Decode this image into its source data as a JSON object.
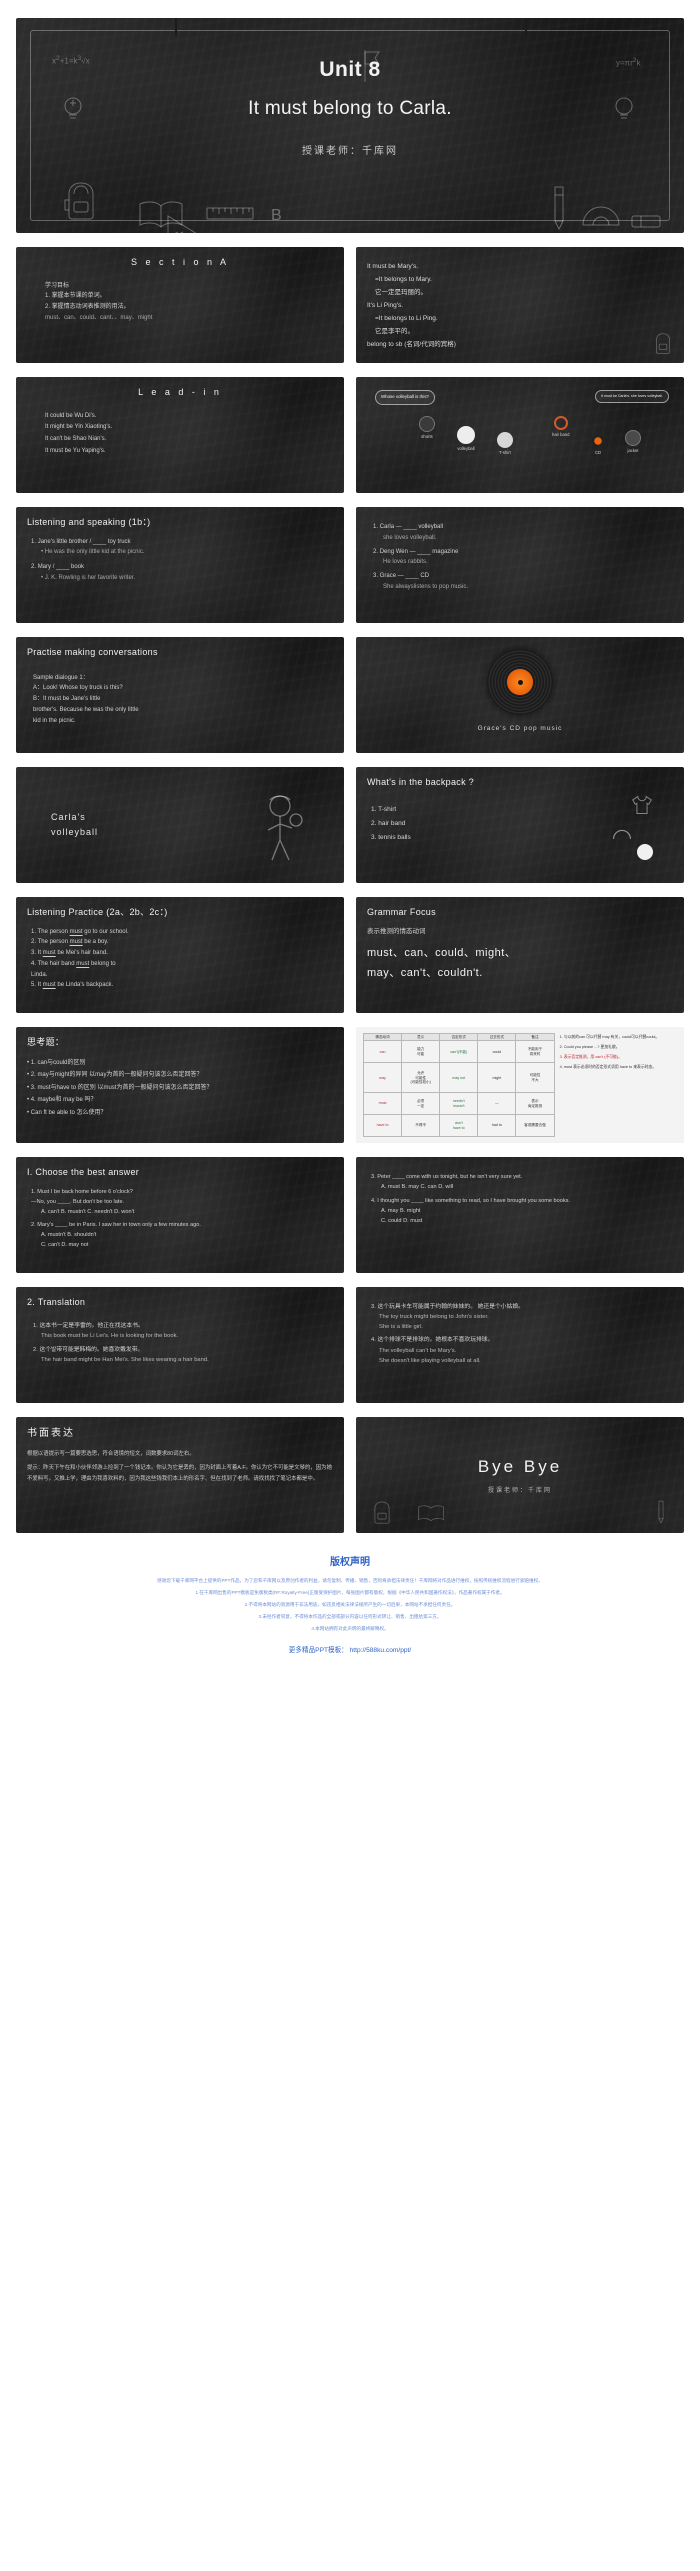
{
  "title_slide": {
    "unit": "Unit 8",
    "main": "It must belong to Carla.",
    "teacher": "授课老师：千库网"
  },
  "slides": [
    {
      "id": "section-a",
      "title": "S e c t i o n   A",
      "lines": [
        "学习目标",
        "1. 掌握本节课的单词。",
        "2. 掌握情态动词表推测的用法。",
        "must、can、could、cant、、may、might"
      ]
    },
    {
      "id": "belong-to",
      "lines": [
        "It must be Mary's.",
        "=It belongs to Mary.",
        "它一定是玛丽的。",
        "It's Li Ping's.",
        "=It belongs to Li Ping.",
        "它是李平的。",
        "belong to sb (名词/代词的宾格)"
      ]
    },
    {
      "id": "lead-in",
      "title": "L e a d - i n",
      "lines": [
        "It could be Wu Di's.",
        "It might be Yin Xiaoting's.",
        "It can't be Shao Nian's.",
        "It must be Yu Yaping's."
      ]
    },
    {
      "id": "whose-picture",
      "bubble_left": "Whose volleyball is this?",
      "bubble_right": "It must be Carla's. she loves volleyball.",
      "items": [
        "shorts",
        "volleyball",
        "T-shirt",
        "hair band",
        "CD",
        "jacket"
      ]
    },
    {
      "id": "listening-speaking-1b",
      "title": "Listening and speaking (1b：)",
      "items": [
        {
          "n": "1.",
          "q": "Jane's little brother / ____ toy truck",
          "a": "He was the only little kid at the picnic."
        },
        {
          "n": "2.",
          "q": "Mary / ____ book",
          "a": "J. K. Rowling  is her favorite writer."
        }
      ]
    },
    {
      "id": "listening-speaking-right",
      "items": [
        {
          "n": "1.",
          "q": "Carla — ____ volleyball",
          "a": "she loves volleyball."
        },
        {
          "n": "2.",
          "q": "Deng Wen — ____ magazine",
          "a": "He loves rabbits."
        },
        {
          "n": "3.",
          "q": "Grace — ____ CD",
          "a": "She alwayslistens to pop music."
        }
      ]
    },
    {
      "id": "practise-conversations",
      "title": "Practise making conversations",
      "lines": [
        "Sample dialogue 1：",
        "A：Look! Whose toy truck is this?",
        "B：It must be Jane's little",
        "brother's. Because he  was the only little",
        "kid in the picnic."
      ]
    },
    {
      "id": "grace-cd",
      "caption": "Grace's CD       pop       music"
    },
    {
      "id": "carla-volleyball",
      "text": "Carla's\nvolleyball"
    },
    {
      "id": "backpack",
      "title": "What's in the backpack ?",
      "items": [
        "1. T-shirt",
        "2. hair band",
        "3. tennis balls"
      ]
    },
    {
      "id": "listening-practice",
      "title": "Listening Practice (2a、2b、2c：)",
      "items": [
        "1. The person <u>must</u>  go to  our school.",
        "2. The person <u>must</u>  be a boy.",
        "3. It <u>must</u>  be Mei's hair band.",
        "4. The hair band <u>must</u>  belong to",
        "Linda.",
        "5. It <u>must</u> be Linda's backpack."
      ]
    },
    {
      "id": "grammar-focus",
      "title": "Grammar Focus",
      "subtitle": "表示推测的情态动词",
      "main": "must、can、could、might、\nmay、can't、couldn't."
    },
    {
      "id": "think",
      "title": "思考题：",
      "items": [
        "• 1. can与could的区别",
        "• 2. may与might的异同  以may为首的一般疑问句该怎么否定回答？",
        "• 3. must与have to 的区别  以must为首的一般疑问句该怎么否定回答？",
        "• 4. maybe和  may  be  吗？",
        "• Can  ft be able to 怎么使用？"
      ]
    },
    {
      "id": "modal-table",
      "table": {
        "headers": [
          "情态动词",
          "意义",
          "否定形式",
          "过去形式",
          "备注"
        ],
        "rows": [
          [
            "can",
            "能力\n可能",
            "can't(不能)",
            "could",
            "不能用于\n将来时"
          ],
          [
            "may",
            "允许\n可能性\n(可能性较小)",
            "may not",
            "might",
            "可能性\n不大"
          ],
          [
            "must",
            "必须\n一定",
            "needn't\nmustn't",
            "—",
            "表示\n肯定推测"
          ],
          [
            "have to",
            "不得不",
            "don't\nhave to",
            "had to",
            "客观需要去做"
          ]
        ]
      },
      "notes": [
        "1. 与以前的can  可以代替 may  有关，could可以代替could。",
        "2. Could you please ...? 更加礼貌。",
        "3. 表示否定推测，用 can't (不可能)。",
        "4. must 表示必须时的否定形式须用 have to 来表示时态。"
      ]
    },
    {
      "id": "choose-best-answer",
      "title": "I. Choose the best answer",
      "items": [
        "1. Must I be back home before 6 o'clock?",
        "—No, you ____. But don't be too late.",
        "A. can't   B. mustn't   C. needn't   D. won't",
        "2. Mary's ____ be in Paris. I saw her in town only a few minutes ago.",
        "A. mustn't   B. shouldn't",
        "C. can't         D. may not"
      ]
    },
    {
      "id": "choose-best-answer-2",
      "items": [
        "3. Peter ____ come with us tonight, but he isn't very sure yet.",
        "A. must   B. may   C. can   D. will",
        "4. I thought you ____ like something to read, so I have brought you some books.",
        "A. may         B. might",
        "C. could       D. must"
      ]
    },
    {
      "id": "translation",
      "title": "2. Translation",
      "items": [
        "1. 这本书一定是李雷的。他正在找这本书。",
        "This book must be Li Lei's. He is looking for the book.",
        "2. 这个발带可能是韩梅的。她喜欢戴发带。",
        "The hair band might be Han Mei's. She likes wearing a hair band."
      ]
    },
    {
      "id": "translation-2",
      "items": [
        "3. 这个玩具卡车可能属于约翰的妹妹的。  她还是个小姑娘。",
        "The toy truck might belong to John's sister.",
        "She is a little girl.",
        "4. 这个排球不是排球的。她根本不喜欢玩排球。",
        "The volleyball can't be Mary's.",
        "She doesn't like playing volleyball at all."
      ]
    },
    {
      "id": "writing",
      "title": "书面表达",
      "lines": [
        "根据以语提示写一篇要思选思，符合语境的短文，词数要求80词左右。",
        "提示：昨天下午在和小伙伴郊游上捡到了一个钱记本。你认为它是丢的，因为封面上写着A.F。你认为它不可能是文琴的，因为她不爱料写。又推上学，理由为我喜欢料的，因为我这些钱我们本上的形名字、但在找到了老师。请找找找了笔记本都是中。"
      ]
    },
    {
      "id": "bye",
      "main": "Bye  Bye",
      "sub": "授课老师：千库网"
    }
  ],
  "copyright": {
    "title": "版权声明",
    "paragraphs": [
      "感谢您下载千库网平台上提供的PPT作品，为了您和千库网以及原创作者的利益，请勿复制、传播、销售，否则将承担法律责任！千库网将对作品进行维权，按照传统维权流程进行索赔维权。",
      "1.在千库网出售的PPT模板是免版税类(RF:Royalty-Free)正版受保护图片，每张图片都有版权，根据《中华人民共和国著作权法》，作品著作权属于作者。",
      "2.不得将本网站的资源用于非法用途，如违反相关法律法规所产生的一切后果，本网站不承担任何责任。",
      "3.未经作者同意，不得将本作品的全部或部分内容以任何形式转让、销售、出租给第三方。",
      "4.本网站拥有对此声明的最终解释权。"
    ],
    "link": "更多精品PPT模板： http://588ku.com/ppt/"
  }
}
